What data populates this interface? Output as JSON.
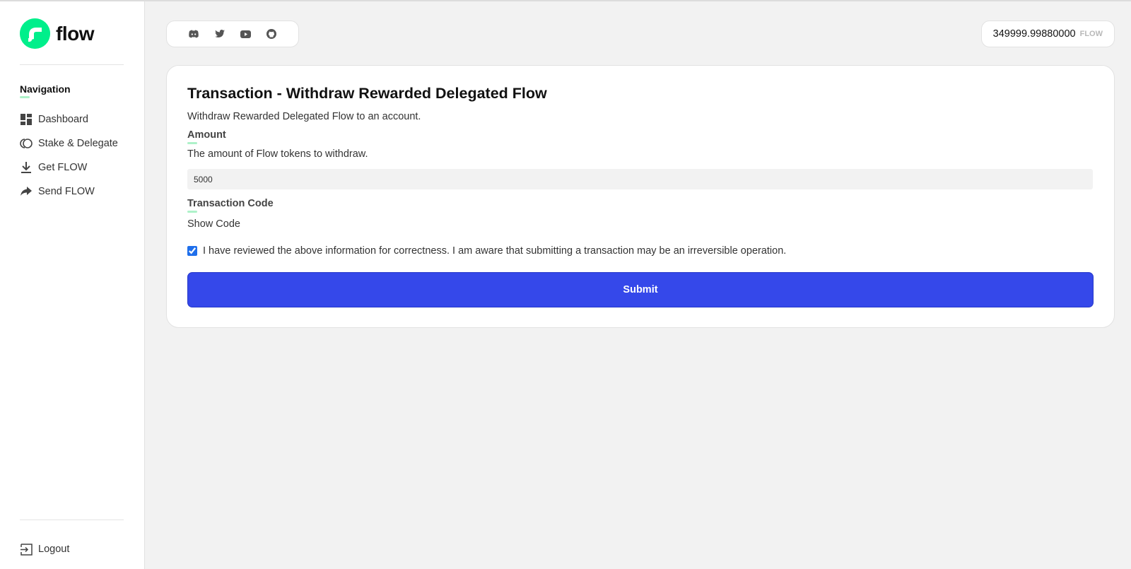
{
  "brand": {
    "name": "flow",
    "accent_color": "#00ef8b"
  },
  "sidebar": {
    "heading": "Navigation",
    "items": [
      {
        "label": "Dashboard",
        "icon": "dashboard-icon"
      },
      {
        "label": "Stake & Delegate",
        "icon": "stake-icon"
      },
      {
        "label": "Get FLOW",
        "icon": "download-icon"
      },
      {
        "label": "Send FLOW",
        "icon": "share-arrow-icon"
      }
    ],
    "logout_label": "Logout"
  },
  "header": {
    "social_icons": [
      "discord-icon",
      "twitter-icon",
      "youtube-icon",
      "github-icon"
    ],
    "balance": {
      "value": "349999.99880000",
      "unit": "FLOW"
    }
  },
  "transaction": {
    "title": "Transaction - Withdraw Rewarded Delegated Flow",
    "description": "Withdraw Rewarded Delegated Flow to an account.",
    "amount": {
      "label": "Amount",
      "help": "The amount of Flow tokens to withdraw.",
      "value": "5000"
    },
    "code": {
      "label": "Transaction Code",
      "toggle": "Show Code"
    },
    "confirm": {
      "text": "I have reviewed the above information for correctness. I am aware that submitting a transaction may be an irreversible operation.",
      "checked": true
    },
    "submit_label": "Submit",
    "submit_color": "#3548ea"
  }
}
